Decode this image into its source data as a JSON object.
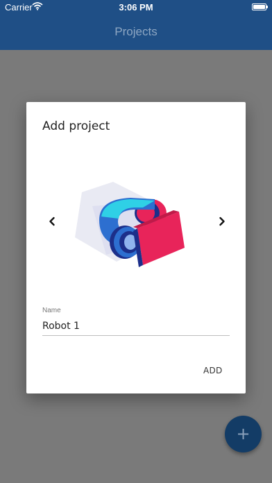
{
  "status_bar": {
    "carrier": "Carrier",
    "time": "3:06 PM",
    "battery_level": 1.0
  },
  "app_bar": {
    "title": "Projects"
  },
  "fab": {
    "icon": "plus-icon",
    "glyph": "+"
  },
  "dialog": {
    "title": "Add project",
    "carousel": {
      "prev_icon": "chevron-left-icon",
      "next_icon": "chevron-right-icon",
      "image": "robot-illustration"
    },
    "name_field": {
      "label": "Name",
      "value": "Robot 1"
    },
    "add_label": "ADD"
  },
  "colors": {
    "app_bar": "#1f4f86",
    "scrim": "#7a7a7a",
    "fab": "#133c66",
    "robot_blue": "#2d6fd0",
    "robot_cyan": "#2fd0e6",
    "robot_red": "#e8245a",
    "robot_navy": "#1c2f8a"
  }
}
